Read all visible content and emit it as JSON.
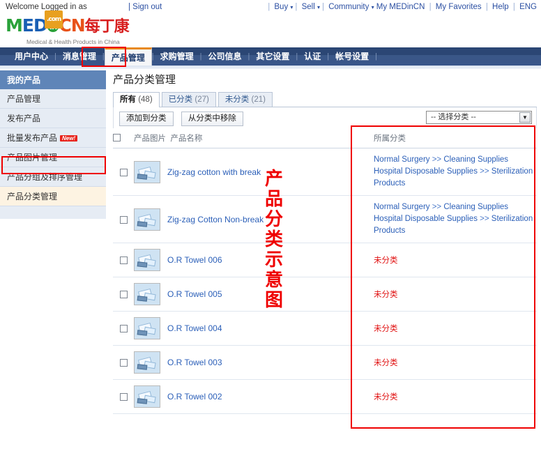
{
  "topbar": {
    "welcome": "Welcome Logged in as",
    "signout": "| Sign out",
    "nav": [
      {
        "label": "Buy",
        "caret": "▾"
      },
      {
        "label": "Sell",
        "caret": "▾"
      },
      {
        "label": "Community",
        "caret": "▾"
      },
      {
        "label": "My MEDinCN",
        "caret": ""
      },
      {
        "label": "My Favorites",
        "caret": ""
      },
      {
        "label": "Help",
        "caret": ""
      },
      {
        "label": "ENG",
        "caret": ""
      }
    ]
  },
  "logo": {
    "part_m": "M",
    "part_ed": "ED",
    "part_in": "in",
    "part_cn": "CN",
    "part_cjk": "每丁康",
    "com": ".com",
    "tagline": "Medical & Health Products in China"
  },
  "mainnav": {
    "items": [
      {
        "label": "用户中心",
        "active": false
      },
      {
        "label": "消息管理",
        "active": false
      },
      {
        "label": "产品管理",
        "active": true
      },
      {
        "label": "求购管理",
        "active": false
      },
      {
        "label": "公司信息",
        "active": false
      },
      {
        "label": "其它设置",
        "active": false
      },
      {
        "label": "认证",
        "active": false
      },
      {
        "label": "帐号设置",
        "active": false
      }
    ],
    "separator": "|"
  },
  "sidebar": {
    "header": "我的产品",
    "items": [
      {
        "label": "产品管理",
        "badge": "",
        "selected": false
      },
      {
        "label": "发布产品",
        "badge": "",
        "selected": false
      },
      {
        "label": "批量发布产品",
        "badge": "New!",
        "selected": false
      },
      {
        "label": "产品图片管理",
        "badge": "",
        "selected": false
      },
      {
        "label": "产品分组及排序管理",
        "badge": "",
        "selected": false
      },
      {
        "label": "产品分类管理",
        "badge": "",
        "selected": true
      }
    ]
  },
  "main": {
    "title": "产品分类管理",
    "tabs": [
      {
        "label": "所有",
        "count": "(48)",
        "active": true
      },
      {
        "label": "已分类",
        "count": "(27)",
        "active": false
      },
      {
        "label": "未分类",
        "count": "(21)",
        "active": false
      }
    ],
    "toolbar": {
      "add_to_category": "添加到分类",
      "remove_from_category": "从分类中移除",
      "select_value": "-- 选择分类 --",
      "select_arrow": "▼"
    },
    "table": {
      "header_image": "产品图片",
      "header_name": "产品名称",
      "header_category": "所属分类",
      "uncategorized_label": "未分类",
      "rows": [
        {
          "name": "Zig-zag cotton with break",
          "categories": [
            {
              "parent": "Normal Surgery",
              "sep": ">>",
              "child": "Cleaning Supplies"
            },
            {
              "parent": "Hospital Disposable Supplies",
              "sep": ">>",
              "child": "Sterilization Products"
            }
          ]
        },
        {
          "name": "Zig-zag Cotton Non-break",
          "categories": [
            {
              "parent": "Normal Surgery",
              "sep": ">>",
              "child": "Cleaning Supplies"
            },
            {
              "parent": "Hospital Disposable Supplies",
              "sep": ">>",
              "child": "Sterilization Products"
            }
          ]
        },
        {
          "name": "O.R Towel 006",
          "categories": []
        },
        {
          "name": "O.R Towel 005",
          "categories": []
        },
        {
          "name": "O.R Towel 004",
          "categories": []
        },
        {
          "name": "O.R Towel 003",
          "categories": []
        },
        {
          "name": "O.R Towel 002",
          "categories": []
        }
      ]
    }
  },
  "annotation": {
    "vertical_text": "产品分类示意图",
    "highlight_color": "#ef0000"
  }
}
